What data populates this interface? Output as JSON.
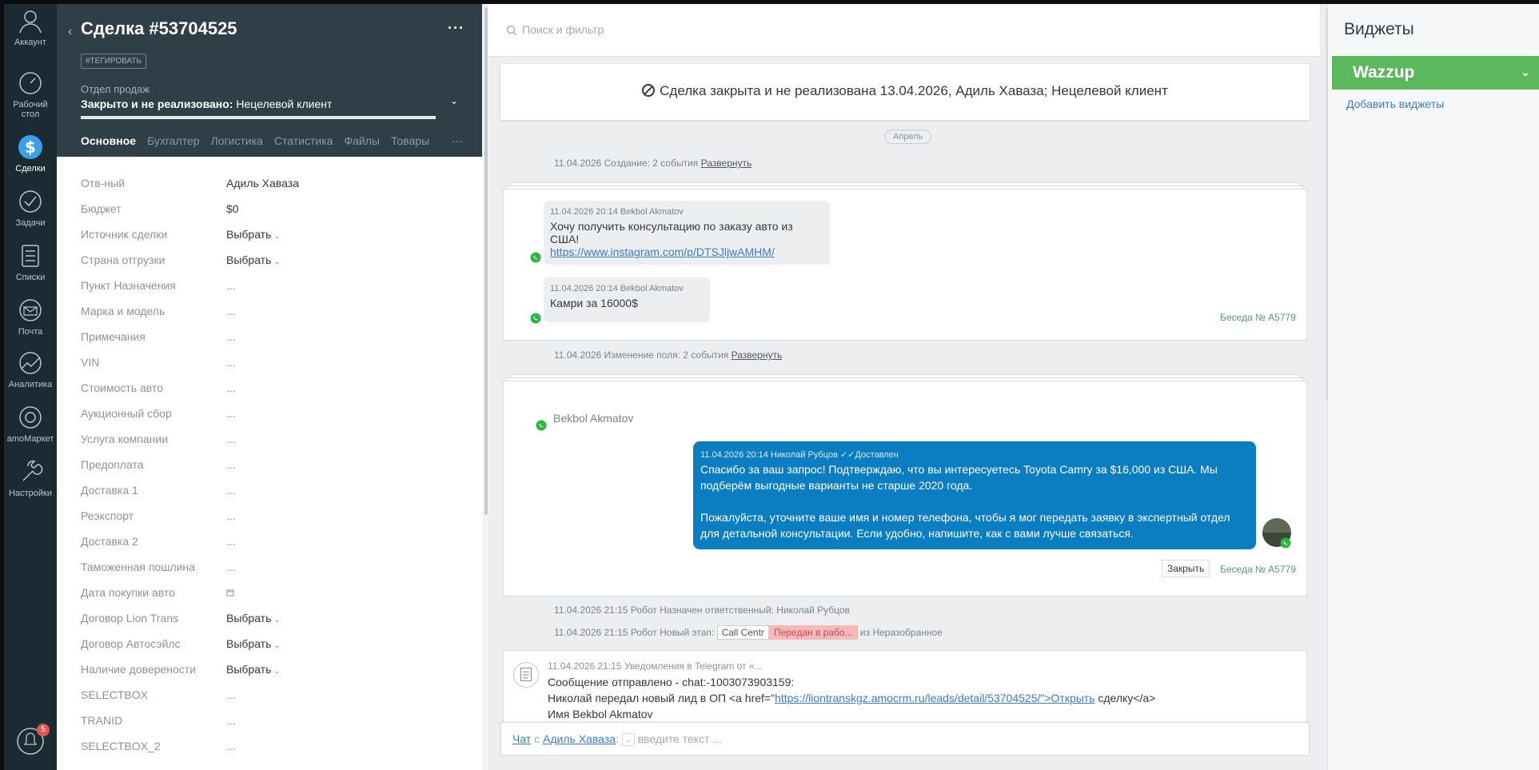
{
  "nav": {
    "account": "Аккаунт",
    "desktop": "Рабочий стол",
    "deals": "Сделки",
    "tasks": "Задачи",
    "lists": "Списки",
    "mail": "Почта",
    "analytics": "Аналитика",
    "market": "amoМаркет",
    "settings": "Настройки",
    "notif_count": "5"
  },
  "card": {
    "title": "Сделка #53704525",
    "tag_button": "#ТЕГИРОВАТЬ",
    "pipeline": "Отдел продаж",
    "status_bold": "Закрыто и не реализовано:",
    "status_reason": " Нецелевой клиент",
    "tabs": [
      "Основное",
      "Бухгалтер",
      "Логистика",
      "Статистика",
      "Файлы",
      "Товары"
    ],
    "tabs_more": "···",
    "more": "···",
    "fields": [
      {
        "label": "Отв-ный",
        "value": "Адиль Хаваза",
        "kind": "text"
      },
      {
        "label": "Бюджет",
        "value": "$0",
        "kind": "text"
      },
      {
        "label": "Источник сделки",
        "value": "Выбрать",
        "kind": "select"
      },
      {
        "label": "Страна отгрузки",
        "value": "Выбрать",
        "kind": "select"
      },
      {
        "label": "Пункт Назначения",
        "value": "...",
        "kind": "dots"
      },
      {
        "label": "Марка и модель",
        "value": "...",
        "kind": "dots"
      },
      {
        "label": "Примечания",
        "value": "...",
        "kind": "dots"
      },
      {
        "label": "VIN",
        "value": "...",
        "kind": "dots"
      },
      {
        "label": "Стоимость авто",
        "value": "...",
        "kind": "dots"
      },
      {
        "label": "Аукционный сбор",
        "value": "...",
        "kind": "dots"
      },
      {
        "label": "Услуга компании",
        "value": "...",
        "kind": "dots"
      },
      {
        "label": "Предоплата",
        "value": "...",
        "kind": "dots"
      },
      {
        "label": "Доставка 1",
        "value": "...",
        "kind": "dots"
      },
      {
        "label": "Реэкспорт",
        "value": "...",
        "kind": "dots"
      },
      {
        "label": "Доставка 2",
        "value": "...",
        "kind": "dots"
      },
      {
        "label": "Таможенная пошлина",
        "value": "...",
        "kind": "dots"
      },
      {
        "label": "Дата покупки авто",
        "value": "",
        "kind": "date"
      },
      {
        "label": "Договор Lion Trans",
        "value": "Выбрать",
        "kind": "select"
      },
      {
        "label": "Договор Автосэйлс",
        "value": "Выбрать",
        "kind": "select"
      },
      {
        "label": "Наличие довереноcти",
        "value": "Выбрать",
        "kind": "select"
      },
      {
        "label": "SELECTBOX",
        "value": "...",
        "kind": "dots"
      },
      {
        "label": "TRANID",
        "value": "...",
        "kind": "dots"
      },
      {
        "label": "SELECTBOX_2",
        "value": "...",
        "kind": "dots"
      }
    ]
  },
  "feed": {
    "search_placeholder": "Поиск и фильтр",
    "closed_banner": "Сделка закрыта и не реализована 13.04.2026, Адиль Хаваза; Нецелевой клиент",
    "month": "Апрель",
    "created_line": "11.04.2026 Создание: 2 события",
    "created_expand": "Развернуть",
    "msg1_meta": "11.04.2026 20:14 Bekbol Akmatov",
    "msg1_text": "Хочу получить консультацию по заказу авто из США!",
    "msg1_link": "https://www.instagram.com/p/DTSJljwAMHM/",
    "msg2_meta": "11.04.2026 20:14 Bekbol Akmatov",
    "msg2_text": "Камри за 16000$",
    "conversation": "Беседа № A5779",
    "change_line": "11.04.2026 Изменение поля: 2 события",
    "change_expand": "Развернуть",
    "contact_name": "Bekbol Akmatov",
    "out_meta": "11.04.2026 20:14 Николай Рубцов",
    "out_status": "Доставлен",
    "out_text_1": "Спасибо за ваш запрос! Подтверждаю, что вы интересуетесь Toyota Camry за $16,000 из США. Мы подберём выгодные варианты не старше 2020 года.",
    "out_text_2": "Пожалуйста, уточните ваше имя и номер телефона, чтобы я мог передать заявку в экспертный отдел для детальной консультации. Если удобно, напишите, как с вами лучше связаться.",
    "close_button": "Закрыть",
    "robot_line_1": "11.04.2026 21:15 Робот Назначен ответственный: Николай Рубцов",
    "robot_line_2_prefix": "11.04.2026 21:15 Робот Новый этап:",
    "stage_from_pipeline": "Call Centr",
    "stage_from": "Передан в рабо...",
    "stage_to": "из Неразобранное",
    "tg_meta": "11.04.2026 21:15 Уведомления в Telegram от «...",
    "tg_line_1": "Сообщение отправлено - chat:-1003073903159:",
    "tg_line_2_prefix": "Николай передал новый лид в ОП <a href=\"",
    "tg_line_2_link": "https://liontranskgz.amocrm.ru/leads/detail/53704525/\">Открыть",
    "tg_line_2_suffix": " сделку</a>",
    "tg_line_3": "Имя Bekbol Akmatov",
    "chat_prefix": "Чат",
    "chat_with": "с",
    "chat_user": "Адиль Хаваза",
    "chat_placeholder": "введите текст ..."
  },
  "widgets": {
    "title": "Виджеты",
    "wazzup": "Wazzup",
    "add": "Добавить виджеты"
  },
  "colors": {
    "nav_bg": "#1b2a33",
    "card_header": "#2e3f48",
    "outgoing_bubble": "#0b7dc1",
    "whatsapp": "#2bb741",
    "wazzup": "#5cb85c",
    "link": "#3a7cc6"
  }
}
